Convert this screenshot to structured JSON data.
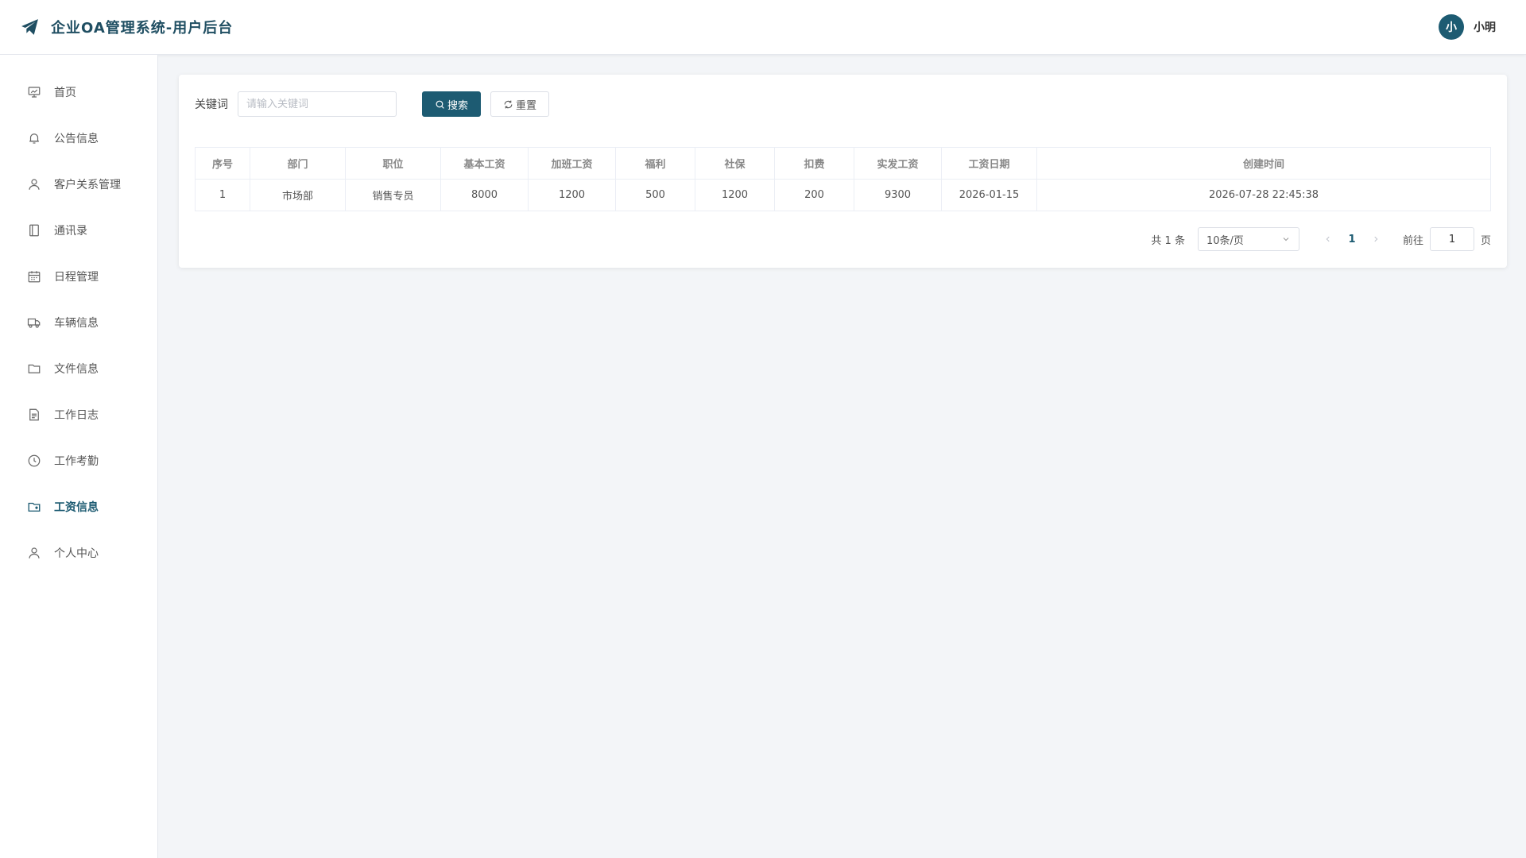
{
  "header": {
    "title": "企业OA管理系统-用户后台",
    "avatar_text": "小",
    "username": "小明"
  },
  "sidebar": {
    "items": [
      {
        "label": "首页",
        "icon": "chart-board-icon"
      },
      {
        "label": "公告信息",
        "icon": "bell-icon"
      },
      {
        "label": "客户关系管理",
        "icon": "user-icon"
      },
      {
        "label": "通讯录",
        "icon": "notebook-icon"
      },
      {
        "label": "日程管理",
        "icon": "calendar-icon"
      },
      {
        "label": "车辆信息",
        "icon": "truck-icon"
      },
      {
        "label": "文件信息",
        "icon": "folder-icon"
      },
      {
        "label": "工作日志",
        "icon": "document-icon"
      },
      {
        "label": "工作考勤",
        "icon": "clock-icon"
      },
      {
        "label": "工资信息",
        "icon": "wallet-folder-icon",
        "active": true
      },
      {
        "label": "个人中心",
        "icon": "user-icon"
      }
    ]
  },
  "search": {
    "label": "关键词",
    "placeholder": "请输入关键词",
    "search_button": "搜索",
    "reset_button": "重置"
  },
  "table": {
    "columns": [
      "序号",
      "部门",
      "职位",
      "基本工资",
      "加班工资",
      "福利",
      "社保",
      "扣费",
      "实发工资",
      "工资日期",
      "创建时间"
    ],
    "rows": [
      [
        "1",
        "市场部",
        "销售专员",
        "8000",
        "1200",
        "500",
        "1200",
        "200",
        "9300",
        "2026-01-15",
        "2026-07-28 22:45:38"
      ]
    ]
  },
  "pagination": {
    "total_text": "共 1 条",
    "page_size": "10条/页",
    "current_page": "1",
    "goto_label": "前往",
    "goto_value": "1",
    "page_suffix": "页"
  },
  "colors": {
    "primary": "#1d5b72",
    "background": "#f3f5f8"
  }
}
